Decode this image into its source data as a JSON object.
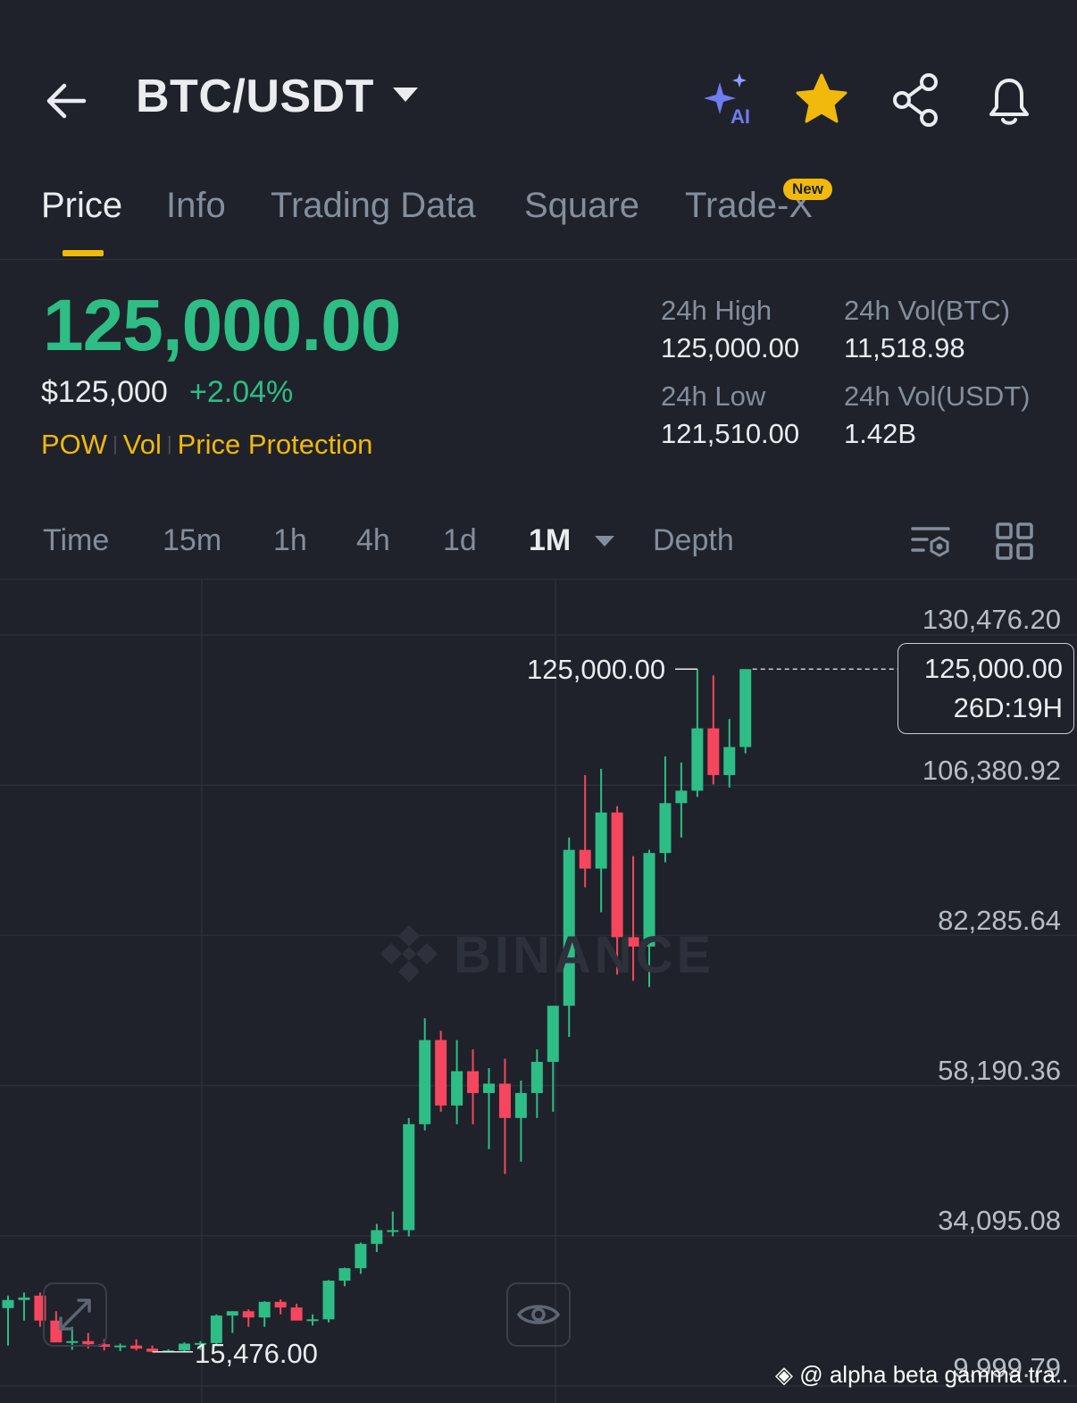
{
  "header": {
    "pair": "BTC/USDT",
    "icons": [
      "back-arrow-icon",
      "ai-sparkle-icon",
      "star-icon",
      "share-icon",
      "bell-icon"
    ],
    "ai_label": "AI"
  },
  "tabs": [
    {
      "label": "Price",
      "active": true
    },
    {
      "label": "Info",
      "active": false
    },
    {
      "label": "Trading Data",
      "active": false
    },
    {
      "label": "Square",
      "active": false
    },
    {
      "label": "Trade-X",
      "active": false,
      "badge": "New"
    }
  ],
  "ticker": {
    "last_price": "125,000.00",
    "usd_price": "$125,000",
    "change_pct": "+2.04%",
    "tags": [
      "POW",
      "Vol",
      "Price Protection"
    ],
    "stats": {
      "high_label": "24h High",
      "high_value": "125,000.00",
      "vol_btc_label": "24h Vol(BTC)",
      "vol_btc_value": "11,518.98",
      "low_label": "24h Low",
      "low_value": "121,510.00",
      "vol_usdt_label": "24h Vol(USDT)",
      "vol_usdt_value": "1.42B"
    }
  },
  "timeframes": {
    "items": [
      "Time",
      "15m",
      "1h",
      "4h",
      "1d",
      "1M",
      "Depth"
    ],
    "selected": "1M"
  },
  "chart_data": {
    "type": "candlestick",
    "interval": "1M",
    "y_axis_labels": [
      "130,476.20",
      "106,380.92",
      "82,285.64",
      "58,190.36",
      "34,095.08",
      "9,999.79"
    ],
    "ylim": [
      9999.79,
      130476.2
    ],
    "high_marker": "125,000.00",
    "low_marker": "15,476.00",
    "current_price": "125,000.00",
    "countdown": "26D:19H",
    "watermark": "BINANCE",
    "colors": {
      "up": "#2ebd85",
      "down": "#f6465d",
      "grid": "#2b2f39"
    },
    "candles": [
      {
        "o": 22500,
        "h": 24500,
        "l": 16500,
        "c": 23800
      },
      {
        "o": 23800,
        "h": 25000,
        "l": 20500,
        "c": 24200
      },
      {
        "o": 24500,
        "h": 25000,
        "l": 19500,
        "c": 20500
      },
      {
        "o": 20500,
        "h": 22000,
        "l": 17000,
        "c": 17000
      },
      {
        "o": 17000,
        "h": 19500,
        "l": 15800,
        "c": 17200
      },
      {
        "o": 17200,
        "h": 18500,
        "l": 16000,
        "c": 16700
      },
      {
        "o": 16700,
        "h": 17500,
        "l": 15700,
        "c": 16300
      },
      {
        "o": 16300,
        "h": 16800,
        "l": 15600,
        "c": 16500
      },
      {
        "o": 16500,
        "h": 17500,
        "l": 15700,
        "c": 16000
      },
      {
        "o": 16000,
        "h": 16500,
        "l": 15476,
        "c": 15500
      },
      {
        "o": 15500,
        "h": 15900,
        "l": 15476,
        "c": 15700
      },
      {
        "o": 15700,
        "h": 17000,
        "l": 15500,
        "c": 16800
      },
      {
        "o": 16800,
        "h": 17200,
        "l": 15800,
        "c": 16900
      },
      {
        "o": 16900,
        "h": 21500,
        "l": 16600,
        "c": 21300
      },
      {
        "o": 21300,
        "h": 22000,
        "l": 18500,
        "c": 22000
      },
      {
        "o": 22000,
        "h": 22300,
        "l": 19500,
        "c": 21000
      },
      {
        "o": 21000,
        "h": 23600,
        "l": 19500,
        "c": 23500
      },
      {
        "o": 23500,
        "h": 23900,
        "l": 21500,
        "c": 22600
      },
      {
        "o": 22600,
        "h": 23200,
        "l": 21000,
        "c": 20500
      },
      {
        "o": 20500,
        "h": 21500,
        "l": 19700,
        "c": 20700
      },
      {
        "o": 20700,
        "h": 27000,
        "l": 20200,
        "c": 26900
      },
      {
        "o": 26900,
        "h": 29000,
        "l": 26000,
        "c": 28900
      },
      {
        "o": 28900,
        "h": 33000,
        "l": 28000,
        "c": 32800
      },
      {
        "o": 32800,
        "h": 36000,
        "l": 31500,
        "c": 35000
      },
      {
        "o": 35000,
        "h": 38000,
        "l": 34000,
        "c": 35000
      },
      {
        "o": 35000,
        "h": 53000,
        "l": 34000,
        "c": 52000
      },
      {
        "o": 52000,
        "h": 69000,
        "l": 51000,
        "c": 65500
      },
      {
        "o": 65500,
        "h": 67000,
        "l": 54000,
        "c": 55000
      },
      {
        "o": 55000,
        "h": 65500,
        "l": 52000,
        "c": 60500
      },
      {
        "o": 60500,
        "h": 64000,
        "l": 52000,
        "c": 57000
      },
      {
        "o": 57000,
        "h": 61000,
        "l": 48000,
        "c": 58500
      },
      {
        "o": 58500,
        "h": 62500,
        "l": 44000,
        "c": 53000
      },
      {
        "o": 53000,
        "h": 59000,
        "l": 46000,
        "c": 57000
      },
      {
        "o": 57000,
        "h": 64000,
        "l": 53000,
        "c": 62000
      },
      {
        "o": 62000,
        "h": 70000,
        "l": 54000,
        "c": 71000
      },
      {
        "o": 71000,
        "h": 98000,
        "l": 66000,
        "c": 96000
      },
      {
        "o": 96000,
        "h": 108000,
        "l": 90000,
        "c": 93000
      },
      {
        "o": 93000,
        "h": 109000,
        "l": 86000,
        "c": 102000
      },
      {
        "o": 102000,
        "h": 103000,
        "l": 76000,
        "c": 82000
      },
      {
        "o": 82000,
        "h": 95000,
        "l": 75000,
        "c": 80500
      },
      {
        "o": 80500,
        "h": 96000,
        "l": 74000,
        "c": 95500
      },
      {
        "o": 95500,
        "h": 111000,
        "l": 94000,
        "c": 103500
      },
      {
        "o": 103500,
        "h": 110000,
        "l": 98000,
        "c": 105500
      },
      {
        "o": 105500,
        "h": 125000,
        "l": 104500,
        "c": 115500
      },
      {
        "o": 115500,
        "h": 124000,
        "l": 106500,
        "c": 108000
      },
      {
        "o": 108000,
        "h": 117000,
        "l": 106000,
        "c": 112500
      },
      {
        "o": 112500,
        "h": 125000,
        "l": 111500,
        "c": 125000
      }
    ]
  },
  "footer": {
    "credit": "@ alpha beta gamma tra..."
  }
}
